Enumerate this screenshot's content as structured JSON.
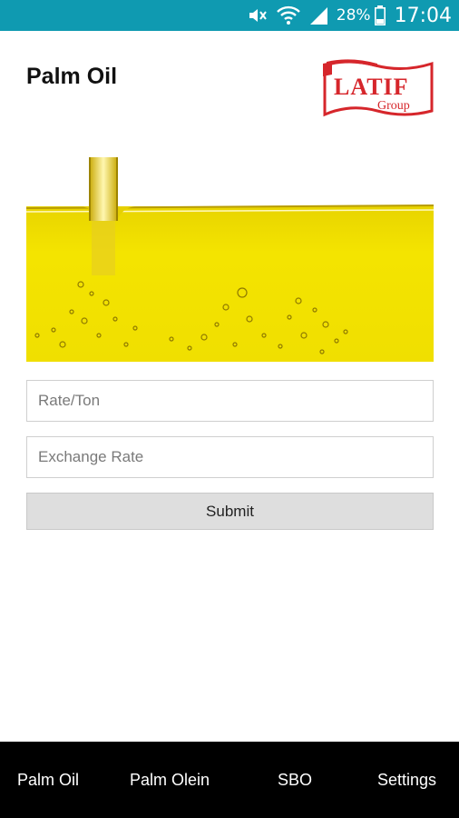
{
  "status_bar": {
    "battery": "28%",
    "time": "17:04",
    "icons": [
      "mute-icon",
      "wifi-icon",
      "signal-icon",
      "battery-icon"
    ]
  },
  "header": {
    "title": "Palm Oil",
    "logo": {
      "name": "LATIF",
      "sub": "Group"
    }
  },
  "form": {
    "rate_placeholder": "Rate/Ton",
    "exchange_placeholder": "Exchange Rate",
    "submit_label": "Submit"
  },
  "bottom_nav": {
    "tabs": [
      {
        "label": "Palm Oil"
      },
      {
        "label": "Palm Olein"
      },
      {
        "label": "SBO"
      },
      {
        "label": "Settings"
      }
    ]
  },
  "colors": {
    "status_bar": "#0f9ab1",
    "oil": "#f2e200",
    "logo_red": "#d6262b",
    "nav_bg": "#000000"
  }
}
